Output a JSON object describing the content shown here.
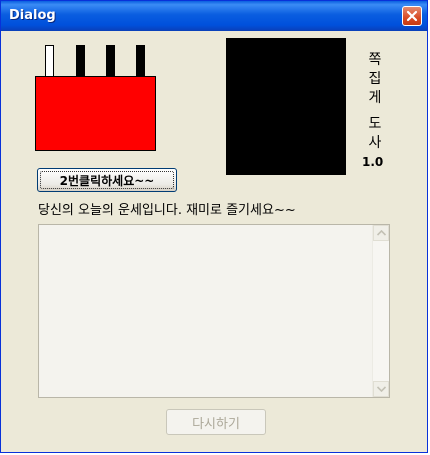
{
  "window": {
    "title": "Dialog"
  },
  "side_text": {
    "chars": [
      "쪽",
      "집",
      "게",
      "도",
      "사"
    ],
    "version": "1.0"
  },
  "buttons": {
    "click_twice": "2번클릭하세요~~",
    "retry": "다시하기"
  },
  "fortune_label": "당신의 오늘의 운세입니다. 재미로 즐기세요~~",
  "fortune_text": "",
  "colors": {
    "title_bar": "#0a5ee0",
    "factory_body": "#ff0000",
    "display_box": "#000000",
    "dialog_bg": "#ece9d8"
  },
  "icons": {
    "close": "close-icon",
    "scroll_up": "arrow-up-icon",
    "scroll_down": "arrow-down-icon"
  }
}
